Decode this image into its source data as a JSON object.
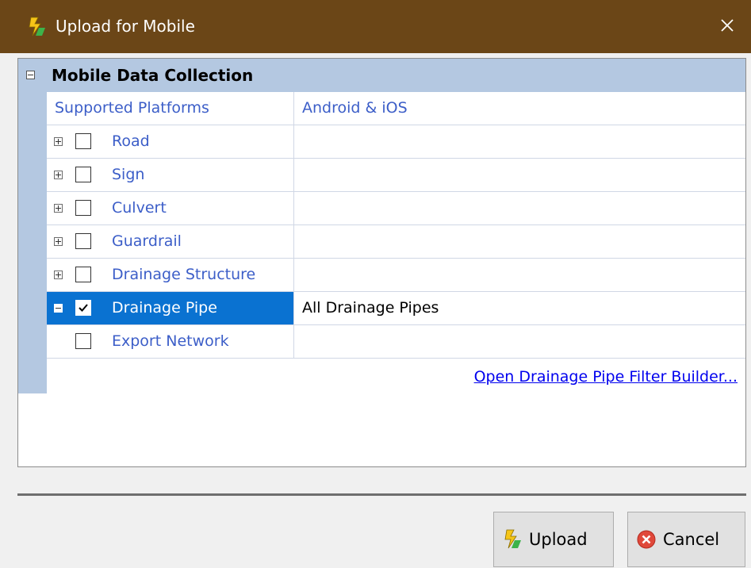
{
  "window": {
    "title": "Upload for Mobile",
    "close_glyph": "✕"
  },
  "category": {
    "label": "Mobile Data Collection",
    "toggle_icon": "collapse-icon"
  },
  "rows": [
    {
      "name": "Supported Platforms",
      "value": "Android & iOS",
      "has_expander": false,
      "has_checkbox": false,
      "checked": false,
      "selected": false
    },
    {
      "name": "Road",
      "value": "",
      "has_expander": true,
      "expanded": false,
      "has_checkbox": true,
      "checked": false,
      "selected": false
    },
    {
      "name": "Sign",
      "value": "",
      "has_expander": true,
      "expanded": false,
      "has_checkbox": true,
      "checked": false,
      "selected": false
    },
    {
      "name": "Culvert",
      "value": "",
      "has_expander": true,
      "expanded": false,
      "has_checkbox": true,
      "checked": false,
      "selected": false
    },
    {
      "name": "Guardrail",
      "value": "",
      "has_expander": true,
      "expanded": false,
      "has_checkbox": true,
      "checked": false,
      "selected": false
    },
    {
      "name": "Drainage Structure",
      "value": "",
      "has_expander": true,
      "expanded": false,
      "has_checkbox": true,
      "checked": false,
      "selected": false
    },
    {
      "name": "Drainage Pipe",
      "value": "All Drainage Pipes",
      "has_expander": true,
      "expanded": true,
      "has_checkbox": true,
      "checked": true,
      "selected": true
    },
    {
      "name": "Export Network",
      "value": "",
      "has_expander": false,
      "has_checkbox": true,
      "checked": false,
      "selected": false
    }
  ],
  "filter_link": "Open Drainage Pipe Filter Builder...",
  "buttons": {
    "upload_label": "Upload",
    "cancel_label": "Cancel"
  },
  "colors": {
    "titlebar": "#6b4617",
    "category_header": "#b4c8e1",
    "selection": "#0a72d1",
    "property_text": "#3c5ec8",
    "link": "#0000ee"
  }
}
